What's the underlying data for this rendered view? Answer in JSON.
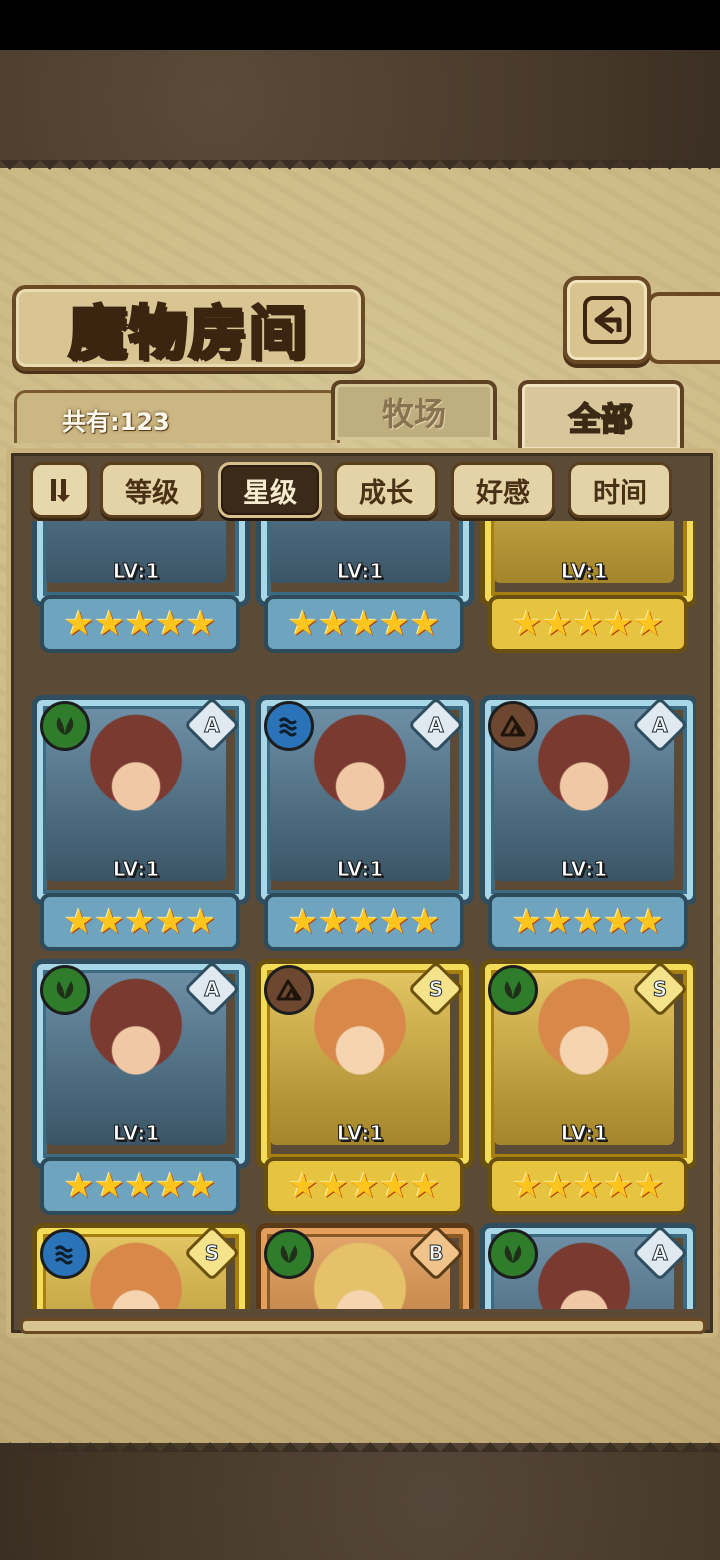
{
  "header": {
    "title": "魔物房间",
    "count_label": "共有:123"
  },
  "tabs": {
    "pasture": "牧场",
    "all": "全部"
  },
  "filters": {
    "items": [
      "等级",
      "星级",
      "成长",
      "好感",
      "时间"
    ],
    "active": "星级"
  },
  "monsters": [
    {
      "lv": "LV:1",
      "stars": "★★★★★",
      "frame": "blue",
      "element": "",
      "rank": ""
    },
    {
      "lv": "LV:1",
      "stars": "★★★★★",
      "frame": "blue",
      "element": "",
      "rank": ""
    },
    {
      "lv": "LV:1",
      "stars": "★★★★★",
      "frame": "gold",
      "element": "",
      "rank": ""
    },
    {
      "lv": "LV:1",
      "stars": "★★★★★",
      "frame": "blue",
      "element": "nature",
      "rank": "A"
    },
    {
      "lv": "LV:1",
      "stars": "★★★★★",
      "frame": "blue",
      "element": "water",
      "rank": "A"
    },
    {
      "lv": "LV:1",
      "stars": "★★★★★",
      "frame": "blue",
      "element": "earth",
      "rank": "A"
    },
    {
      "lv": "LV:1",
      "stars": "★★★★★",
      "frame": "blue",
      "element": "nature",
      "rank": "A"
    },
    {
      "lv": "LV:1",
      "stars": "★★★★★",
      "frame": "gold",
      "element": "earth",
      "rank": "S"
    },
    {
      "lv": "LV:1",
      "stars": "★★★★★",
      "frame": "gold",
      "element": "nature",
      "rank": "S"
    },
    {
      "lv": "",
      "stars": "",
      "frame": "gold",
      "element": "water",
      "rank": "S"
    },
    {
      "lv": "",
      "stars": "",
      "frame": "bronze",
      "element": "nature",
      "rank": "B"
    },
    {
      "lv": "",
      "stars": "",
      "frame": "blue",
      "element": "nature",
      "rank": "A"
    }
  ]
}
